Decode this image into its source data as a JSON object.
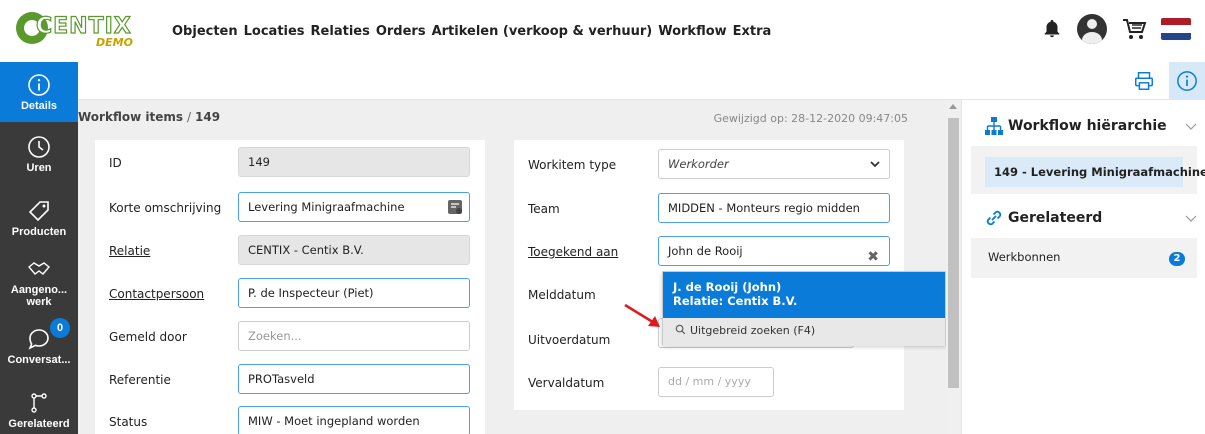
{
  "app": {
    "logo_text": "CENTIX",
    "logo_sub": "DEMO"
  },
  "nav": {
    "items": [
      "Objecten",
      "Locaties",
      "Relaties",
      "Orders",
      "Artikelen (verkoop & verhuur)",
      "Workflow",
      "Extra"
    ]
  },
  "rail": {
    "items": [
      {
        "label": "Details",
        "icon": "info-icon",
        "active": true
      },
      {
        "label": "Uren",
        "icon": "clock-icon"
      },
      {
        "label": "Producten",
        "icon": "tag-icon"
      },
      {
        "label": "Aangeno... werk",
        "label1": "Aangeno...",
        "label2": "werk",
        "icon": "handshake-icon"
      },
      {
        "label": "Conversat...",
        "icon": "chat-icon",
        "badge": "0"
      },
      {
        "label": "Gerelateerd",
        "icon": "hierarchy-icon"
      }
    ]
  },
  "breadcrumb": {
    "parent": "Workflow items",
    "separator": "/",
    "current": "149"
  },
  "modified": "Gewijzigd op: 28-12-2020 09:47:05",
  "form_left": {
    "id_label": "ID",
    "id_value": "149",
    "omschrijving_label": "Korte omschrijving",
    "omschrijving_value": "Levering Minigraafmachine",
    "relatie_label": "Relatie",
    "relatie_value": "CENTIX - Centix B.V.",
    "contact_label": "Contactpersoon",
    "contact_value": "P. de Inspecteur (Piet)",
    "gemeld_label": "Gemeld door",
    "gemeld_placeholder": "Zoeken...",
    "referentie_label": "Referentie",
    "referentie_value": "PROTasveld",
    "status_label": "Status",
    "status_value": "MIW - Moet ingepland worden"
  },
  "form_right": {
    "type_label": "Workitem type",
    "type_value": "Werkorder",
    "team_label": "Team",
    "team_value": "MIDDEN - Monteurs regio midden",
    "toegekend_label": "Toegekend aan",
    "toegekend_value": "John de Rooij",
    "melddatum_label": "Melddatum",
    "uitvoer_label": "Uitvoerdatum",
    "verval_label": "Vervaldatum",
    "verval_placeholder": "dd / mm / yyyy"
  },
  "suggest": {
    "name": "J. de Rooij (John)",
    "relatie": "Relatie: Centix B.V.",
    "search": "Uitgebreid zoeken (F4)"
  },
  "right_panel": {
    "hier_title": "Workflow hiërarchie",
    "hier_item": "149 - Levering Minigraafmachine",
    "rel_title": "Gerelateerd",
    "werkbonnen_label": "Werkbonnen",
    "werkbonnen_count": "2"
  },
  "colors": {
    "accent": "#0a7bd8",
    "rail_bg": "#3a3a3a",
    "flag_red": "#ae1c28",
    "flag_white": "#ffffff",
    "flag_blue": "#21468b"
  }
}
